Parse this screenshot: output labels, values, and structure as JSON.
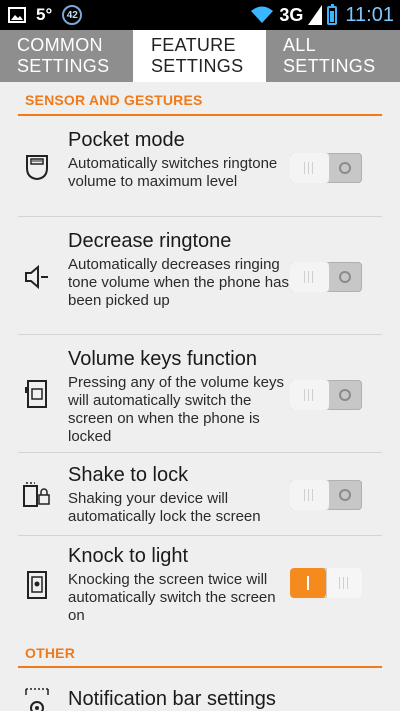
{
  "status_bar": {
    "temperature": "5°",
    "notification_count": "42",
    "network": "3G",
    "clock": "11:01"
  },
  "tabs": [
    {
      "label": "COMMON SETTINGS",
      "selected": false
    },
    {
      "label": "FEATURE SETTINGS",
      "selected": true
    },
    {
      "label": "ALL SETTINGS",
      "selected": false
    }
  ],
  "sections": {
    "sensor": {
      "heading": "SENSOR AND GESTURES",
      "items": [
        {
          "title": "Pocket mode",
          "description": "Automatically switches ringtone volume to maximum level",
          "enabled": false,
          "icon": "pocket-icon"
        },
        {
          "title": "Decrease ringtone",
          "description": "Automatically decreases ringing tone volume when the phone has been picked up",
          "enabled": false,
          "icon": "speaker-icon"
        },
        {
          "title": "Volume keys function",
          "description": "Pressing any of the volume keys will automatically switch the screen on when the phone is locked",
          "enabled": false,
          "icon": "volume-keys-icon"
        },
        {
          "title": "Shake to lock",
          "description": "Shaking your device will automatically lock the screen",
          "enabled": false,
          "icon": "shake-lock-icon"
        },
        {
          "title": "Knock to light",
          "description": "Knocking the screen twice will automatically switch the screen on",
          "enabled": true,
          "icon": "knock-icon"
        }
      ]
    },
    "other": {
      "heading": "OTHER",
      "items": [
        {
          "title": "Notification bar settings",
          "icon": "notification-bar-icon"
        }
      ]
    }
  },
  "colors": {
    "accent": "#f07a1a",
    "tab_bar": "#8e8e8e",
    "background": "#efefef"
  }
}
